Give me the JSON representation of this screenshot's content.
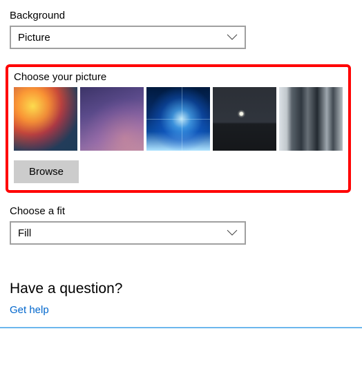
{
  "background": {
    "label": "Background",
    "selected": "Picture"
  },
  "choose_picture": {
    "label": "Choose your picture",
    "thumbnails": [
      {
        "name": "abstract-warm-gradient"
      },
      {
        "name": "purple-gradient"
      },
      {
        "name": "windows-light-burst"
      },
      {
        "name": "night-moon"
      },
      {
        "name": "grey-cliffs"
      }
    ],
    "browse_label": "Browse"
  },
  "fit": {
    "label": "Choose a fit",
    "selected": "Fill"
  },
  "help": {
    "question": "Have a question?",
    "link": "Get help"
  }
}
